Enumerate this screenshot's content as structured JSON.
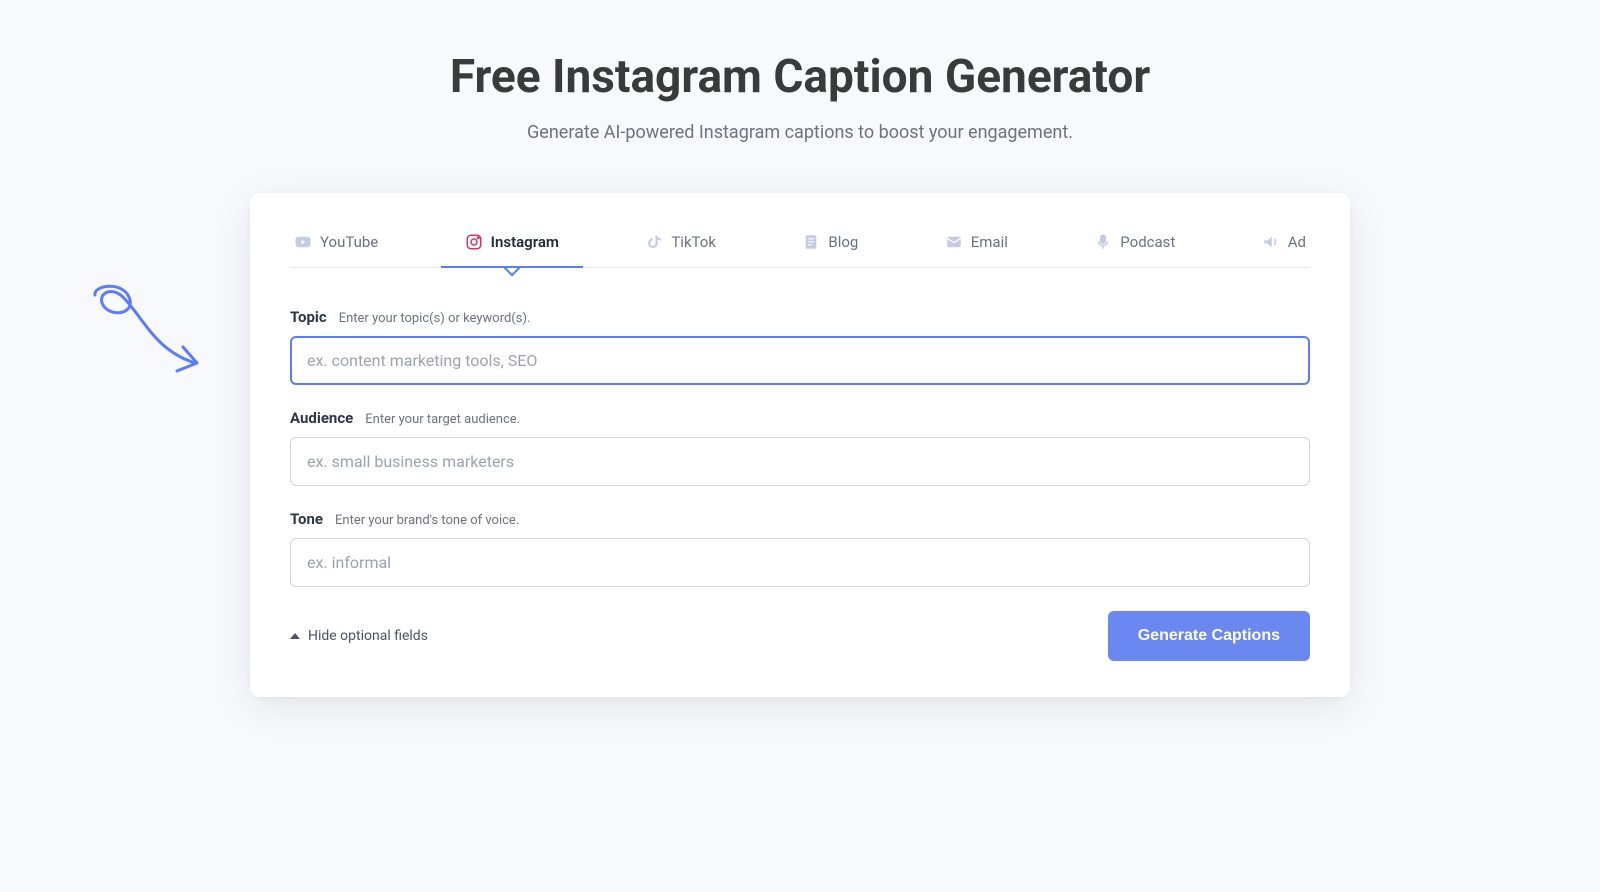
{
  "page": {
    "title": "Free Instagram Caption Generator",
    "subtitle": "Generate AI-powered Instagram captions to boost your engagement."
  },
  "tabs": [
    {
      "label": "YouTube",
      "icon": "youtube-icon",
      "active": false
    },
    {
      "label": "Instagram",
      "icon": "instagram-icon",
      "active": true
    },
    {
      "label": "TikTok",
      "icon": "tiktok-icon",
      "active": false
    },
    {
      "label": "Blog",
      "icon": "blog-icon",
      "active": false
    },
    {
      "label": "Email",
      "icon": "email-icon",
      "active": false
    },
    {
      "label": "Podcast",
      "icon": "podcast-icon",
      "active": false
    },
    {
      "label": "Ad",
      "icon": "ad-icon",
      "active": false
    }
  ],
  "form": {
    "topic": {
      "label": "Topic",
      "hint": "Enter your topic(s) or keyword(s).",
      "placeholder": "ex. content marketing tools, SEO",
      "value": ""
    },
    "audience": {
      "label": "Audience",
      "hint": "Enter your target audience.",
      "placeholder": "ex. small business marketers",
      "value": ""
    },
    "tone": {
      "label": "Tone",
      "hint": "Enter your brand's tone of voice.",
      "placeholder": "ex. informal",
      "value": ""
    },
    "toggle_label": "Hide optional fields",
    "submit_label": "Generate Captions"
  },
  "colors": {
    "accent": "#5b7cff",
    "button": "#6b87f0",
    "instagram": "#d6336c"
  }
}
